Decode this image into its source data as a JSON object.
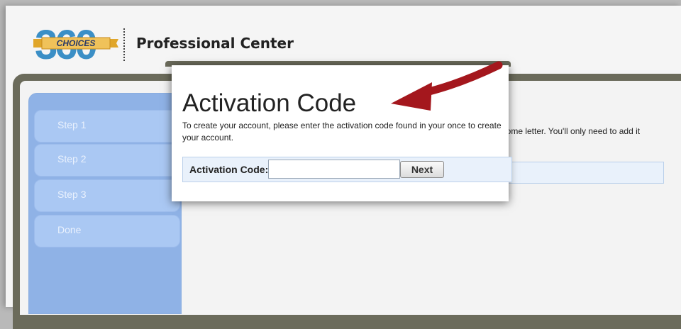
{
  "header": {
    "logo_text": "CHOICES",
    "logo_number": "360",
    "title": "Professional Center"
  },
  "sidebar": {
    "steps": [
      {
        "label": "Step 1"
      },
      {
        "label": "Step 2"
      },
      {
        "label": "Step 3"
      },
      {
        "label": "Done"
      }
    ]
  },
  "content": {
    "partial_text": "lcome letter. You'll only need to add it"
  },
  "modal": {
    "title": "Activation Code",
    "description": "To create your account, please enter the activation code found in your once to create your account.",
    "field_label": "Activation Code:",
    "input_value": "",
    "next_label": "Next"
  },
  "colors": {
    "frame": "#6b6b5b",
    "sidebar": "#8fb2e6",
    "step": "#aac8f3",
    "arrow": "#a4171d"
  },
  "icons": {
    "annotation": "arrow-icon"
  }
}
